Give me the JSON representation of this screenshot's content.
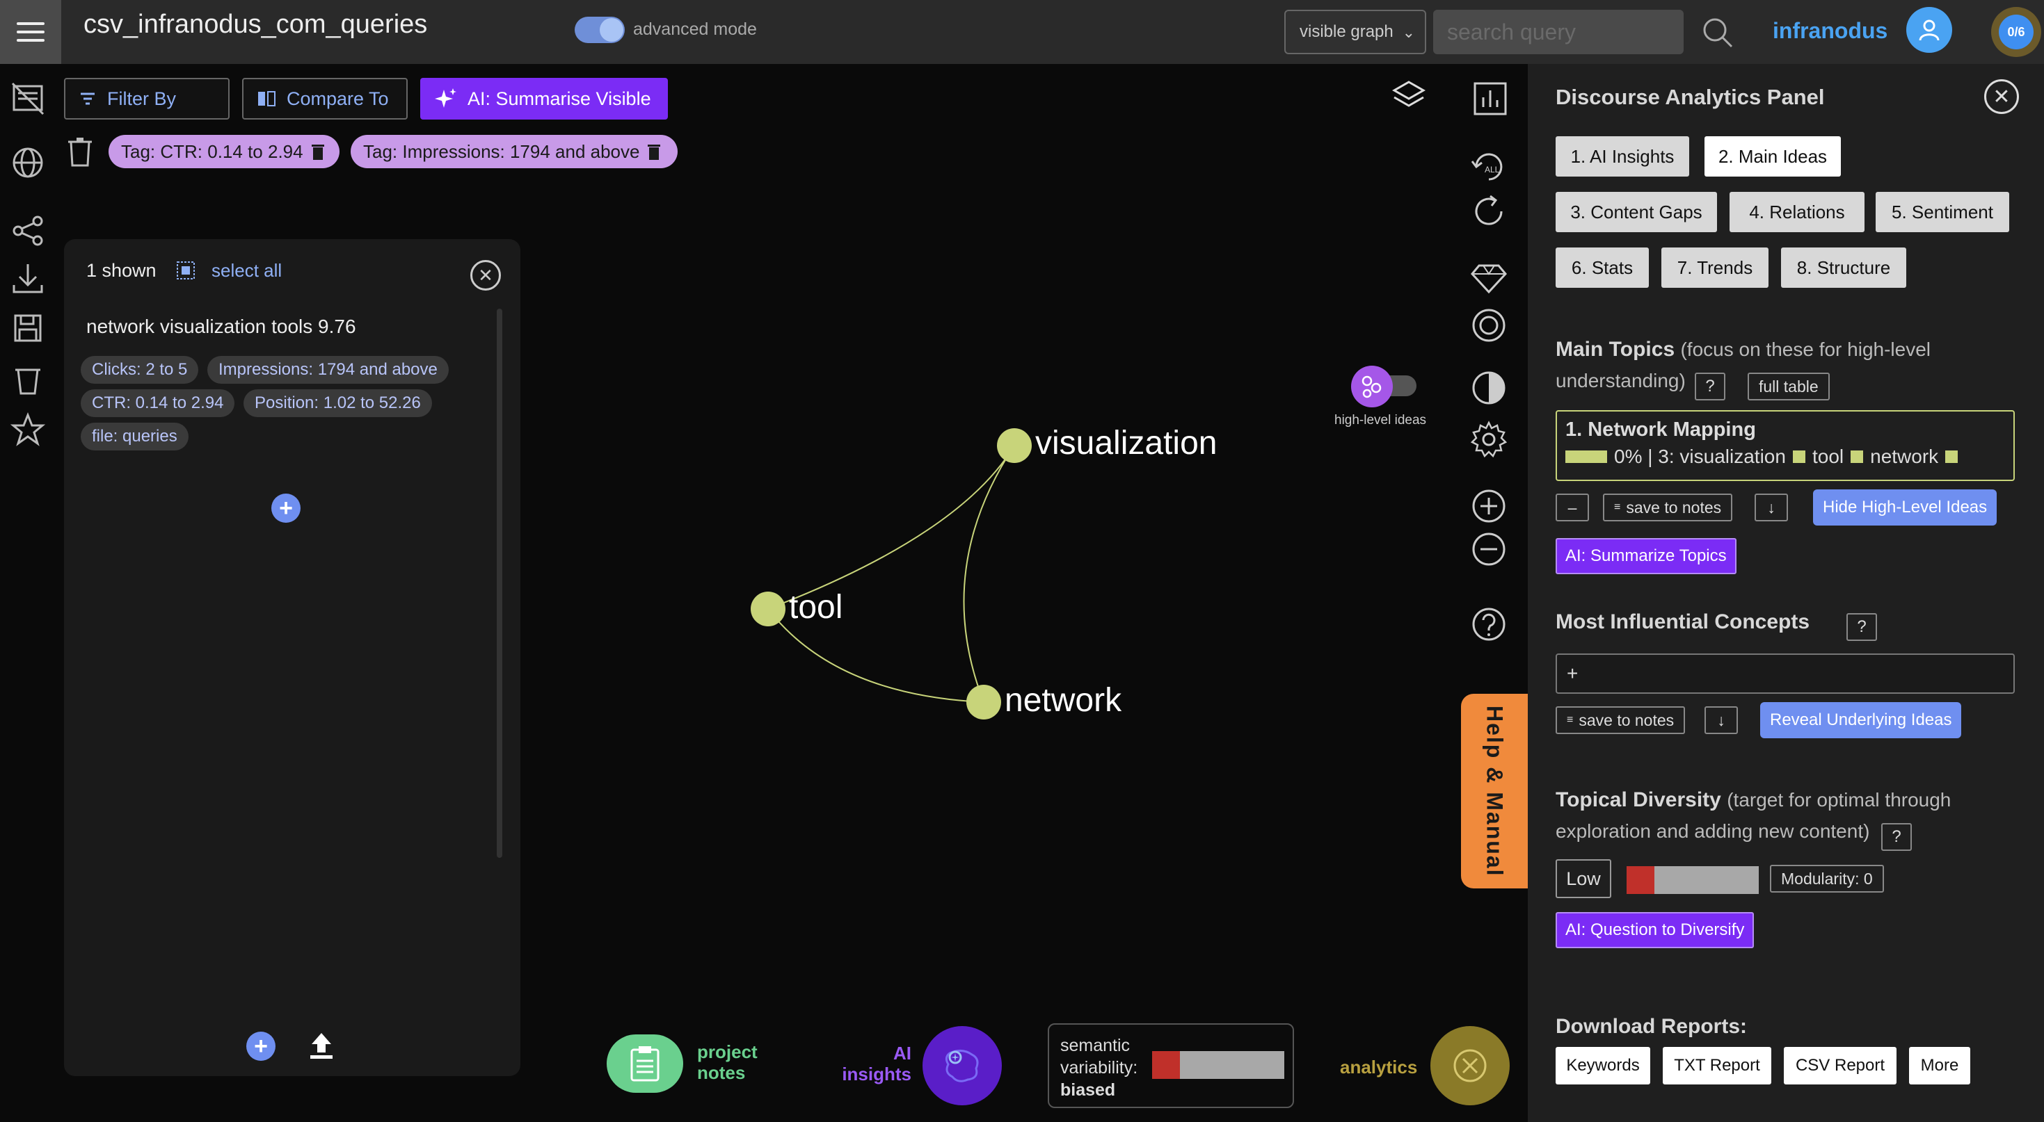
{
  "topbar": {
    "title": "csv_infranodus_com_queries",
    "mode_label": "advanced mode",
    "graph_select": "visible graph",
    "search_placeholder": "search query",
    "brand": "infranodus",
    "counter": "0/6"
  },
  "toolbar": {
    "filter_label": "Filter By",
    "compare_label": "Compare To",
    "summarise_label": "AI: Summarise Visible"
  },
  "tags": [
    "Tag: CTR: 0.14 to 2.94",
    "Tag: Impressions: 1794 and above"
  ],
  "results": {
    "shown": "1 shown",
    "select_all": "select all",
    "title": "network visualization tools 9.76",
    "chips": [
      "Clicks: 2 to 5",
      "Impressions: 1794 and above",
      "CTR: 0.14 to 2.94",
      "Position: 1.02 to 52.26",
      "file: queries"
    ]
  },
  "graph": {
    "nodes": [
      "visualization",
      "tool",
      "network"
    ],
    "node_color": "#c8d47a"
  },
  "canvas": {
    "high_level_label": "high-level ideas",
    "help_tab": "Help & Manual"
  },
  "bottom": {
    "project_notes": [
      "project",
      "notes"
    ],
    "ai_insights": [
      "AI",
      "insights"
    ],
    "variability_label": "semantic",
    "variability_label2": "variability:",
    "variability_value": "biased",
    "analytics": "analytics"
  },
  "panel": {
    "title": "Discourse Analytics Panel",
    "tabs": [
      "1. AI Insights",
      "2. Main Ideas",
      "3. Content Gaps",
      "4. Relations",
      "5. Sentiment",
      "6. Stats",
      "7. Trends",
      "8. Structure"
    ],
    "active_tab": "2. Main Ideas",
    "main_topics": {
      "title": "Main Topics",
      "sub": "(focus on these for high-level",
      "sub2": "understanding)",
      "help": "?",
      "full_table": "full table",
      "topic_title": "1. Network Mapping",
      "topic_pct": "0% | 3: visualization",
      "topic_w2": "tool",
      "topic_w3": "network",
      "minus": "–",
      "save": "save to notes",
      "down": "↓",
      "hide": "Hide High-Level Ideas",
      "ai_btn": "AI: Summarize Topics"
    },
    "concepts": {
      "title": "Most Influential Concepts",
      "help": "?",
      "input_value": "+",
      "save": "save to notes",
      "down": "↓",
      "reveal": "Reveal Underlying Ideas"
    },
    "diversity": {
      "title": "Topical Diversity",
      "sub": "(target for optimal through",
      "sub2": "exploration and adding new content)",
      "help": "?",
      "level": "Low",
      "modularity": "Modularity: 0",
      "ai_btn": "AI: Question to Diversify"
    },
    "reports": {
      "title": "Download Reports:",
      "buttons": [
        "Keywords",
        "TXT Report",
        "CSV Report",
        "More"
      ]
    }
  }
}
